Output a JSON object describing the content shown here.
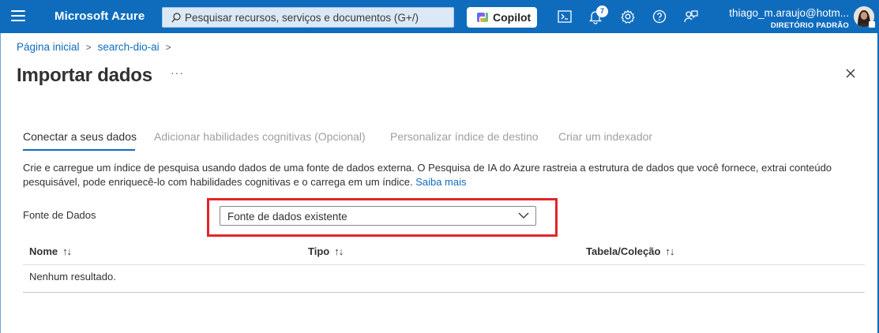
{
  "topbar": {
    "brand": "Microsoft Azure",
    "search_placeholder": "Pesquisar recursos, serviços e documentos (G+/)",
    "copilot_label": "Copilot",
    "notification_count": "7",
    "user_name": "thiago_m.araujo@hotm...",
    "user_directory": "DIRETÓRIO PADRÃO",
    "icons": [
      "menu-icon",
      "search-icon",
      "copilot-icon",
      "cloud-shell-icon",
      "bell-icon",
      "gear-icon",
      "help-icon",
      "feedback-icon",
      "avatar",
      "lock-icon"
    ],
    "accent_color": "#0f6cbd"
  },
  "breadcrumb": {
    "items": [
      "Página inicial",
      "search-dio-ai"
    ]
  },
  "page": {
    "title": "Importar dados",
    "more_label": "···"
  },
  "tabs": [
    {
      "label": "Conectar a seus dados",
      "active": true
    },
    {
      "label": "Adicionar habilidades cognitivas (Opcional)",
      "active": false
    },
    {
      "label": "Personalizar índice de destino",
      "active": false
    },
    {
      "label": "Criar um indexador",
      "active": false
    }
  ],
  "description": {
    "text": "Crie e carregue um índice de pesquisa usando dados de uma fonte de dados externa. O Pesquisa de IA do Azure rastreia a estrutura de dados que você fornece, extrai conteúdo pesquisável, pode enriquecê-lo com habilidades cognitivas e o carrega em um índice.",
    "link": "Saiba mais"
  },
  "datasource": {
    "label": "Fonte de Dados",
    "selected": "Fonte de dados existente",
    "highlight_color": "#e3242b"
  },
  "table": {
    "columns": [
      "Nome",
      "Tipo",
      "Tabela/Coleção"
    ],
    "sort_glyph": "↑↓",
    "empty_text": "Nenhum resultado."
  }
}
